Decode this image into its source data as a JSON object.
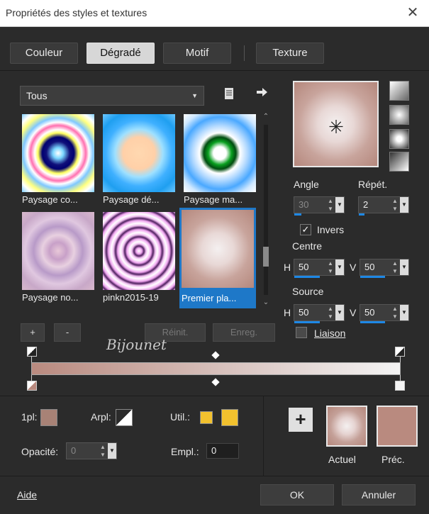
{
  "window": {
    "title": "Propriétés des styles et textures",
    "close_label": "✕"
  },
  "tabs": [
    {
      "label": "Couleur"
    },
    {
      "label": "Dégradé"
    },
    {
      "label": "Motif"
    },
    {
      "label": "Texture"
    }
  ],
  "library": {
    "category": "Tous",
    "items": [
      {
        "label": "Paysage co..."
      },
      {
        "label": "Paysage dé..."
      },
      {
        "label": "Paysage ma..."
      },
      {
        "label": "Paysage no..."
      },
      {
        "label": "pinkn2015-19"
      },
      {
        "label": "Premier pla..."
      }
    ],
    "add_label": "+",
    "remove_label": "-",
    "reset_label": "Réinit.",
    "save_label": "Enreg."
  },
  "watermark": "Bijounet",
  "gradient": {
    "angle_label": "Angle",
    "angle_value": "30",
    "repeat_label": "Répét.",
    "repeat_value": "2",
    "invert_label": "Invers",
    "center_label": "Centre",
    "center_h_label": "H",
    "center_h": "50",
    "center_v_label": "V",
    "center_v": "50",
    "source_label": "Source",
    "source_h_label": "H",
    "source_h": "50",
    "source_v_label": "V",
    "source_v": "50",
    "link_label": "Liaison"
  },
  "stop": {
    "fpl_label": "1pl:",
    "arpl_label": "Arpl:",
    "util_label": "Util.:",
    "opacity_label": "Opacité:",
    "opacity_value": "0",
    "empl_label": "Empl.:",
    "empl_value": "0"
  },
  "compare": {
    "current_label": "Actuel",
    "previous_label": "Préc.",
    "add_label": "+"
  },
  "footer": {
    "help_label": "Aide",
    "ok_label": "OK",
    "cancel_label": "Annuler"
  },
  "colors": {
    "accent": "#1e78c8",
    "gradient_base": "#b98a7f",
    "util_color": "#f2c12e"
  },
  "icons": {
    "close": "close-icon",
    "doc": "document-icon",
    "arrow": "arrow-right-icon",
    "radial": "radial-center-icon"
  }
}
